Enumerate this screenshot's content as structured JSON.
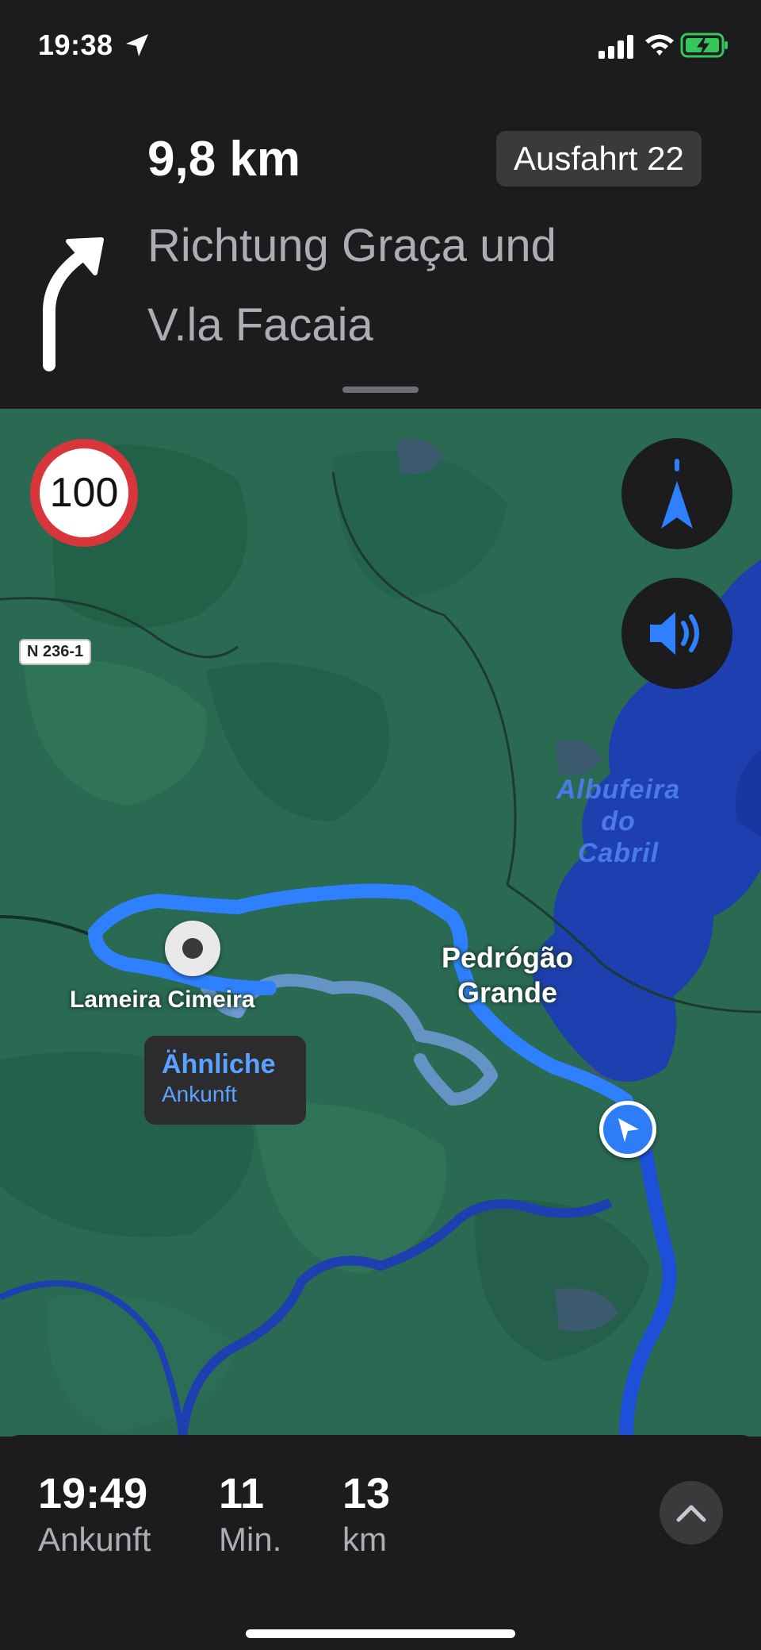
{
  "status_bar": {
    "time": "19:38",
    "icons": [
      "location-arrow-icon",
      "cellular-signal-icon",
      "wifi-icon",
      "battery-charging-icon"
    ]
  },
  "maneuver": {
    "icon": "turn-right-arrow-icon",
    "distance": "9,8 km",
    "exit": "Ausfahrt 22",
    "direction_line1": "Richtung Graça und",
    "direction_line2": "V.la Facaia"
  },
  "map": {
    "speed_limit": "100",
    "road_label": "N 236-1",
    "water_label_line1": "Albufeira",
    "water_label_line2": "do",
    "water_label_line3": "Cabril",
    "town_line1": "Pedrógão",
    "town_line2": "Grande",
    "destination": "Lameira Cimeira",
    "alternative_title": "Ähnliche",
    "alternative_sub": "Ankunft",
    "colors": {
      "route": "#2f80ff",
      "alternative_route": "#6f9ad8",
      "land": "#2a6a52",
      "water": "#1e3fb0"
    }
  },
  "trip": {
    "arrival_value": "19:49",
    "arrival_label": "Ankunft",
    "minutes_value": "11",
    "minutes_label": "Min.",
    "distance_value": "13",
    "distance_label": "km"
  }
}
